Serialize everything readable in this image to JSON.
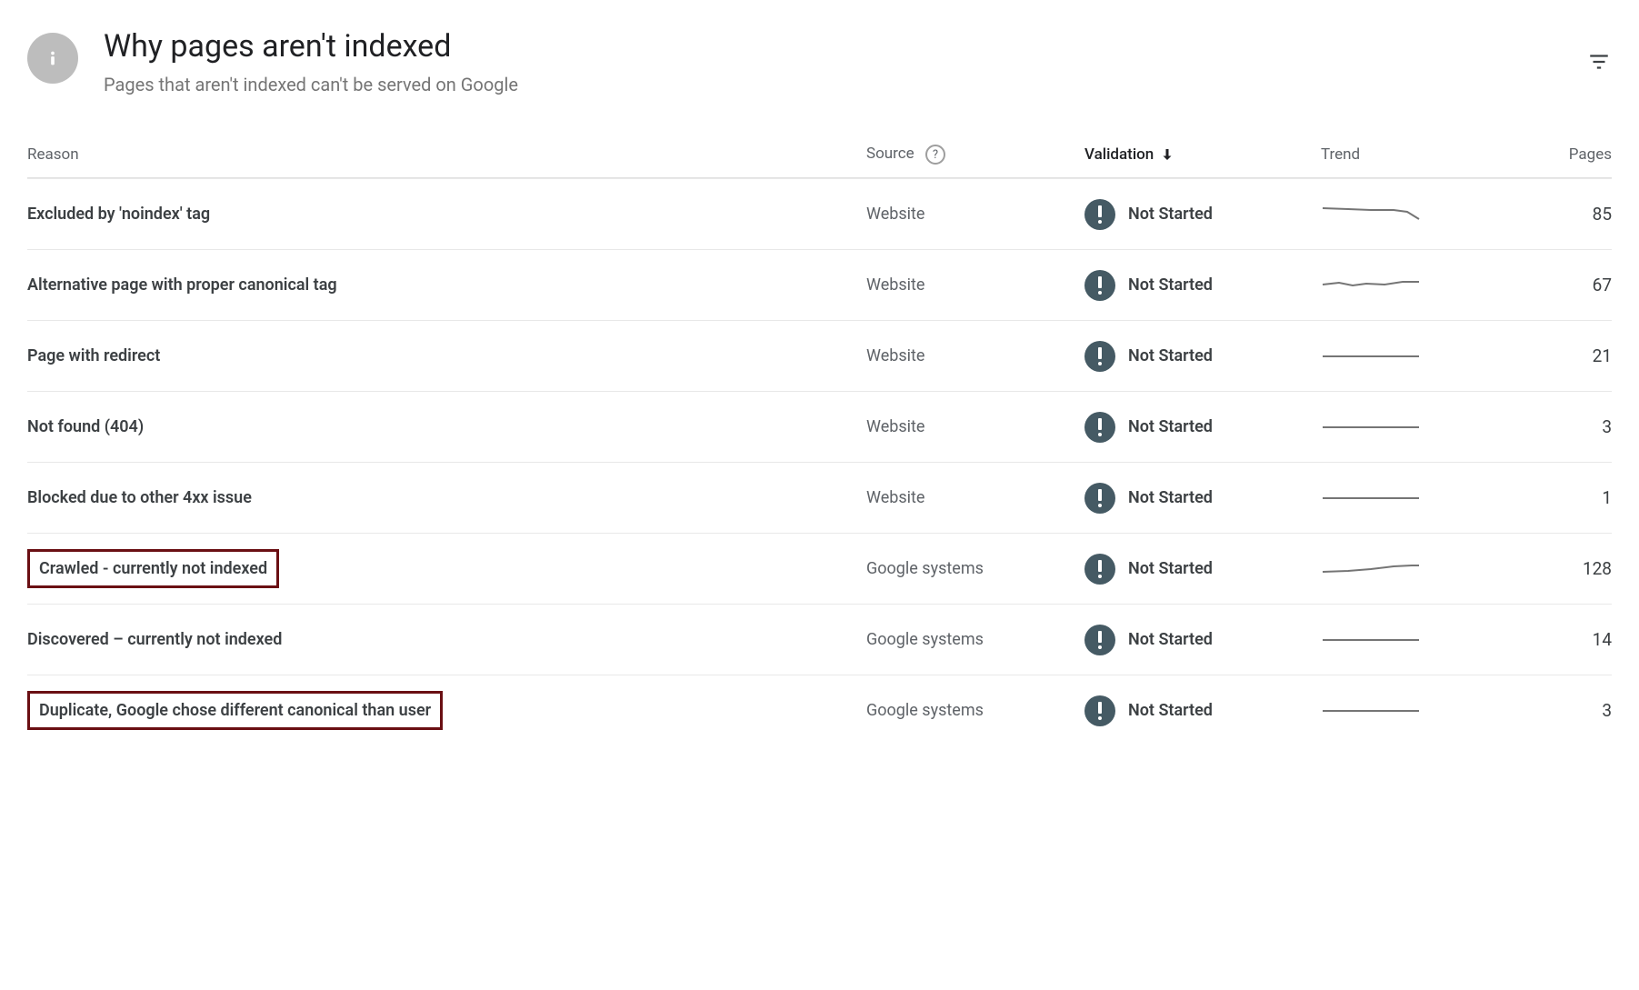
{
  "header": {
    "title": "Why pages aren't indexed",
    "subtitle": "Pages that aren't indexed can't be served on Google"
  },
  "columns": {
    "reason": "Reason",
    "source": "Source",
    "validation": "Validation",
    "trend": "Trend",
    "pages": "Pages"
  },
  "rows": [
    {
      "reason": "Excluded by 'noindex' tag",
      "source": "Website",
      "validation": "Not Started",
      "pages": "85",
      "trend": "decline",
      "highlight": false
    },
    {
      "reason": "Alternative page with proper canonical tag",
      "source": "Website",
      "validation": "Not Started",
      "pages": "67",
      "trend": "wave",
      "highlight": false
    },
    {
      "reason": "Page with redirect",
      "source": "Website",
      "validation": "Not Started",
      "pages": "21",
      "trend": "flat",
      "highlight": false
    },
    {
      "reason": "Not found (404)",
      "source": "Website",
      "validation": "Not Started",
      "pages": "3",
      "trend": "flat",
      "highlight": false
    },
    {
      "reason": "Blocked due to other 4xx issue",
      "source": "Website",
      "validation": "Not Started",
      "pages": "1",
      "trend": "flat",
      "highlight": false
    },
    {
      "reason": "Crawled - currently not indexed",
      "source": "Google systems",
      "validation": "Not Started",
      "pages": "128",
      "trend": "rise",
      "highlight": true
    },
    {
      "reason": "Discovered – currently not indexed",
      "source": "Google systems",
      "validation": "Not Started",
      "pages": "14",
      "trend": "flat",
      "highlight": false
    },
    {
      "reason": "Duplicate, Google chose different canonical than user",
      "source": "Google systems",
      "validation": "Not Started",
      "pages": "3",
      "trend": "flat",
      "highlight": true
    }
  ]
}
